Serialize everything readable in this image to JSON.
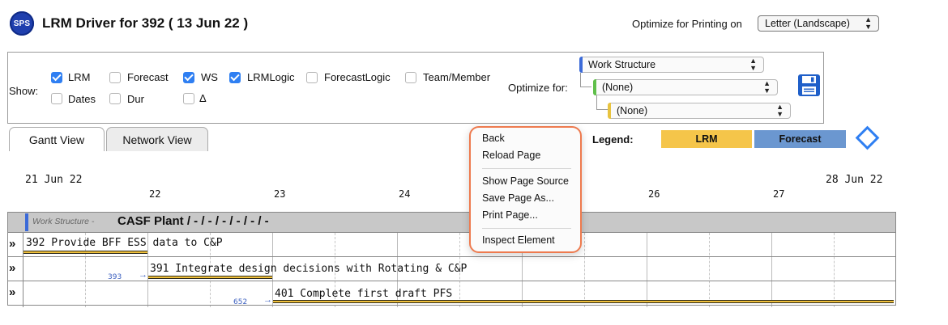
{
  "header": {
    "logo_text": "SPS",
    "title": "LRM Driver for 392 ( 13 Jun 22 )",
    "print_label": "Optimize for Printing on",
    "print_value": "Letter (Landscape)"
  },
  "options": {
    "show_label": "Show:",
    "checkboxes": [
      {
        "label": "LRM",
        "checked": true
      },
      {
        "label": "Forecast",
        "checked": false
      },
      {
        "label": "WS",
        "checked": true
      },
      {
        "label": "LRMLogic",
        "checked": true
      },
      {
        "label": "ForecastLogic",
        "checked": false
      },
      {
        "label": "Team/Member",
        "checked": false
      },
      {
        "label": "Dates",
        "checked": false
      },
      {
        "label": "Dur",
        "checked": false
      },
      {
        "label": "Δ",
        "checked": false
      }
    ],
    "optimize_label": "Optimize for:",
    "selects": [
      "Work Structure",
      "(None)",
      "(None)"
    ]
  },
  "tabs": [
    {
      "label": "Gantt View",
      "active": true
    },
    {
      "label": "Network View",
      "active": false
    }
  ],
  "legend": {
    "label": "Legend:",
    "items": [
      {
        "label": "LRM",
        "color": "#f5c54a"
      },
      {
        "label": "Forecast",
        "color": "#6b97d0"
      }
    ]
  },
  "timeline": {
    "start": "21 Jun 22",
    "end": "28 Jun 22",
    "ticks": [
      "22",
      "23",
      "24",
      "26",
      "27"
    ]
  },
  "gantt": {
    "ws_prefix": "Work Structure -",
    "ws_name": "CASF Plant / - / - / - / - / - / -",
    "rows": [
      {
        "chevron": "»",
        "text": "392 Provide BFF ESS data to C&P",
        "dep": ""
      },
      {
        "chevron": "»",
        "text": "391 Integrate design decisions with Rotating & C&P",
        "dep": "393"
      },
      {
        "chevron": "»",
        "text": "401 Complete first draft PFS",
        "dep": "652"
      }
    ]
  },
  "context_menu": {
    "items": [
      "Back",
      "Reload Page",
      "Show Page Source",
      "Save Page As...",
      "Print Page...",
      "Inspect Element"
    ]
  }
}
